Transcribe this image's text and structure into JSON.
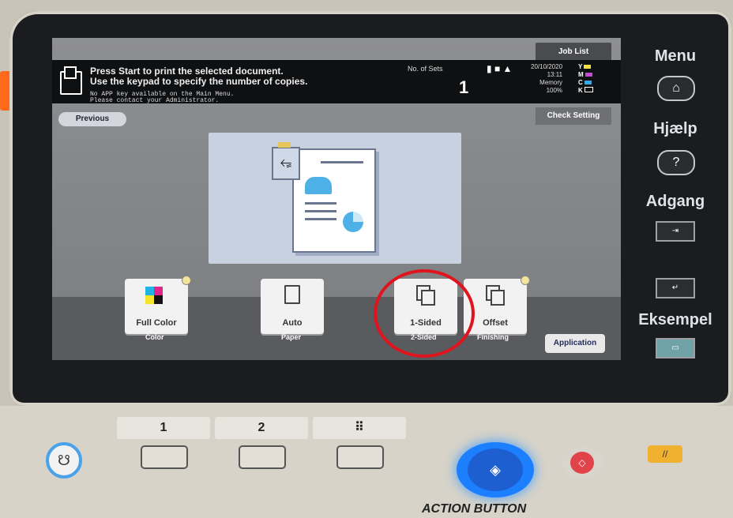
{
  "statusbar": {
    "line1": "Press Start to print the selected document.",
    "line2": "Use the keypad to specify the number of copies.",
    "notice_line1": "No APP key available on the Main Menu.",
    "notice_line2": "Please contact your Administrator.",
    "sets_label": "No. of Sets",
    "sets_value": "1",
    "date": "20/10/2020",
    "time": "13:11",
    "memory_label": "Memory",
    "memory_value": "100%",
    "toner": [
      "Y",
      "M",
      "C",
      "K"
    ]
  },
  "topbuttons": {
    "job_list": "Job List",
    "check_setting": "Check Setting",
    "previous": "Previous"
  },
  "tiles": [
    {
      "label": "Full Color",
      "caption": "Color"
    },
    {
      "label": "Auto",
      "caption": "Paper"
    },
    {
      "label": "1-Sided",
      "caption": "2-Sided"
    },
    {
      "label": "Offset",
      "caption": "Finishing"
    }
  ],
  "application_label": "Application",
  "side": {
    "menu": "Menu",
    "help": "Hjælp",
    "help_btn": "?",
    "access": "Adgang",
    "sample": "Eksempel"
  },
  "keys": {
    "k1": "1",
    "k2": "2"
  },
  "action_button": "ACTION BUTTON",
  "colors": {
    "highlight_circle": "#e0141d",
    "start_ring": "#1b7fff",
    "stop": "#e0434a",
    "reset": "#f0b030"
  }
}
